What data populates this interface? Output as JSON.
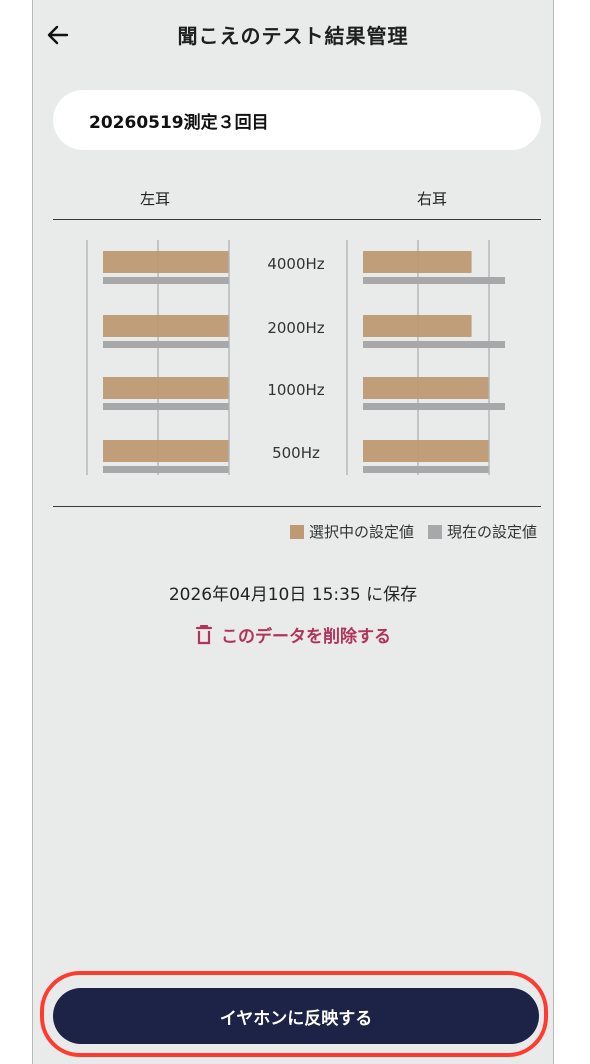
{
  "header": {
    "title": "聞こえのテスト結果管理",
    "back_icon": "arrow-left-icon"
  },
  "record": {
    "label": "20260519測定３回目"
  },
  "ears": {
    "left": "左耳",
    "right": "右耳"
  },
  "chart_data": {
    "type": "bar",
    "orientation": "horizontal",
    "categories": [
      "4000Hz",
      "2000Hz",
      "1000Hz",
      "500Hz"
    ],
    "panels": [
      {
        "name": "左耳",
        "series": [
          {
            "name": "選択中の設定値",
            "values": [
              3,
              3,
              3,
              3
            ]
          },
          {
            "name": "現在の設定値",
            "values": [
              3,
              3,
              3,
              3
            ]
          }
        ]
      },
      {
        "name": "右耳",
        "series": [
          {
            "name": "選択中の設定値",
            "values": [
              2.6,
              2.6,
              3,
              3
            ]
          },
          {
            "name": "現在の設定値",
            "values": [
              3.4,
              3.4,
              3.4,
              3
            ]
          }
        ]
      }
    ],
    "xlim": [
      0,
      3.4
    ],
    "grid": true,
    "legend_placement": "bottom-right",
    "colors": {
      "selected": "#bd9a73",
      "current": "#a8a8aa"
    }
  },
  "legend": {
    "selected": "選択中の設定値",
    "current": "現在の設定値"
  },
  "saved_text": "2026年04月10日 15:35 に保存",
  "delete_label": "このデータを削除する",
  "delete_icon": "trash-icon",
  "apply_button": "イヤホンに反映する",
  "colors": {
    "accent": "#b3345a",
    "button": "#1c2347",
    "highlight": "#ff3b30"
  }
}
